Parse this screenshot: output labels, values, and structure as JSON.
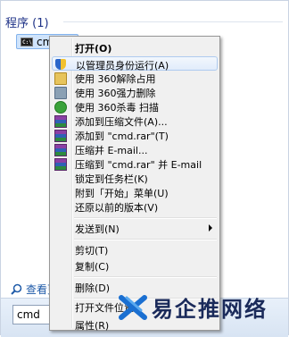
{
  "start_panel": {
    "section_header": "程序 (1)",
    "result_label": "cmd",
    "see_more": "查看更",
    "search_value": "cmd"
  },
  "context_menu": {
    "items": [
      {
        "label": "打开(O)",
        "bold": true,
        "icon": ""
      },
      {
        "label": "以管理员身份运行(A)",
        "icon": "uac-shield-icon",
        "hover": true
      },
      {
        "label": "使用 360解除占用",
        "icon": "360-folder-icon"
      },
      {
        "label": "使用 360强力删除",
        "icon": "360-shredder-icon"
      },
      {
        "label": "使用 360杀毒 扫描",
        "icon": "360-antivirus-icon"
      },
      {
        "label": "添加到压缩文件(A)...",
        "icon": "winrar-icon"
      },
      {
        "label": "添加到 \"cmd.rar\"(T)",
        "icon": "winrar-icon"
      },
      {
        "label": "压缩并 E-mail...",
        "icon": "winrar-icon"
      },
      {
        "label": "压缩到 \"cmd.rar\" 并 E-mail",
        "icon": "winrar-icon"
      },
      {
        "label": "锁定到任务栏(K)",
        "icon": ""
      },
      {
        "label": "附到「开始」菜单(U)",
        "icon": ""
      },
      {
        "label": "还原以前的版本(V)",
        "icon": ""
      },
      {
        "label": "发送到(N)",
        "icon": "",
        "submenu": true
      },
      {
        "label": "剪切(T)",
        "icon": ""
      },
      {
        "label": "复制(C)",
        "icon": ""
      },
      {
        "label": "删除(D)",
        "icon": ""
      },
      {
        "label": "打开文件位置",
        "icon": ""
      },
      {
        "label": "属性(R)",
        "icon": ""
      }
    ]
  },
  "watermark": {
    "text": "易企推网络"
  },
  "colors": {
    "header": "#1e3287",
    "hover_border": "#aecbef",
    "menu_bg": "#f0f0f0"
  }
}
